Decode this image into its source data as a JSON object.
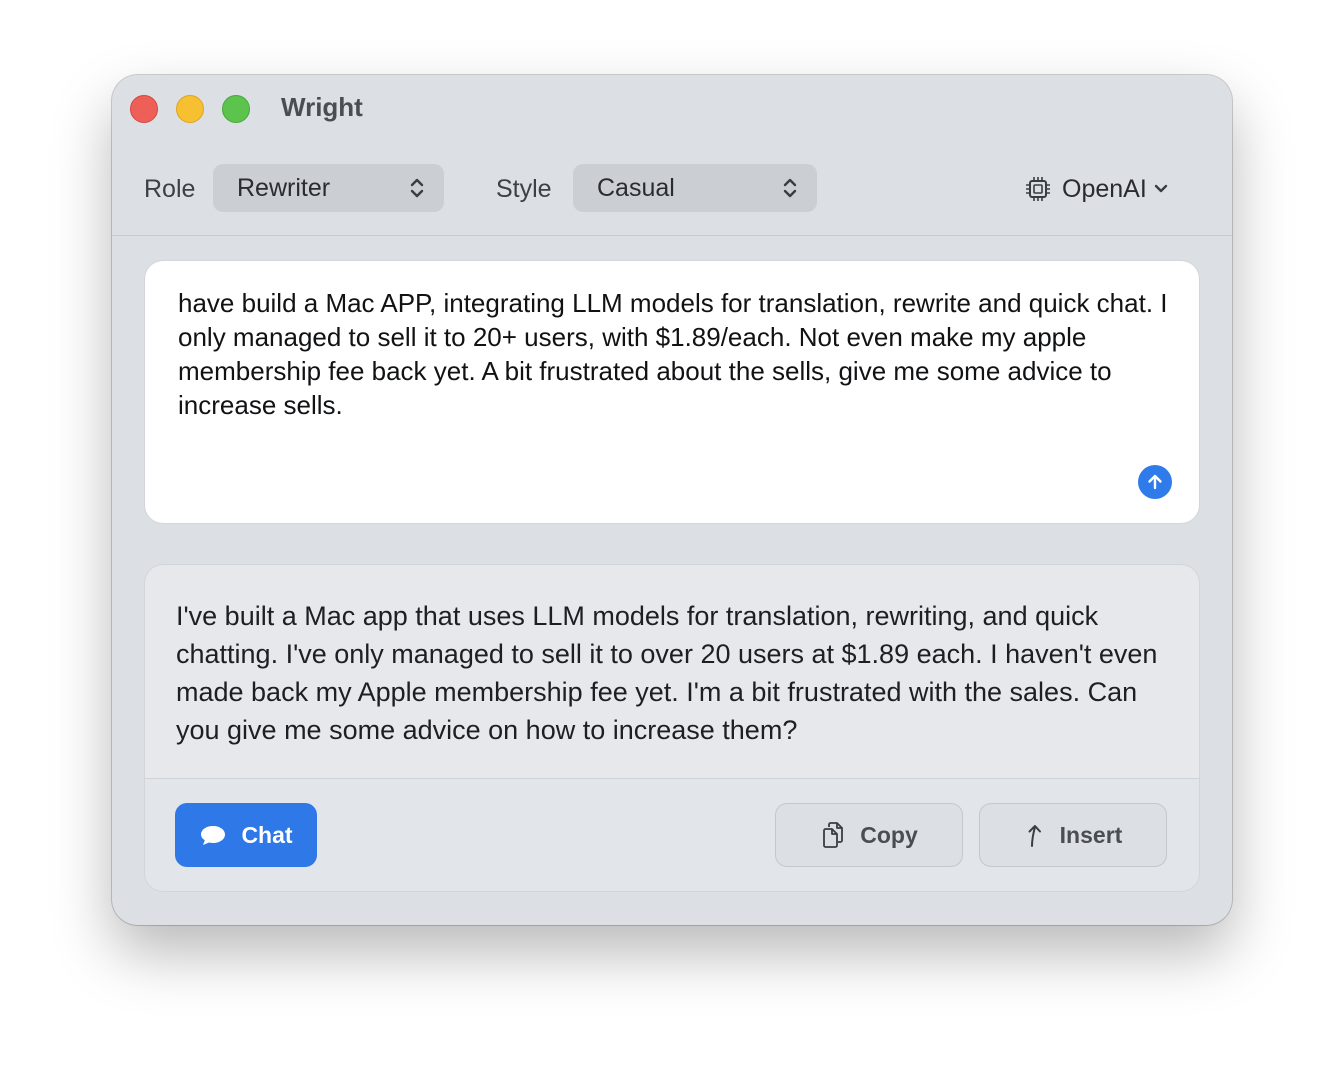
{
  "window": {
    "title": "Wright"
  },
  "toolbar": {
    "role_label": "Role",
    "role_value": "Rewriter",
    "style_label": "Style",
    "style_value": "Casual",
    "provider": "OpenAI"
  },
  "input": {
    "text": "have build a Mac APP, integrating LLM models for translation, rewrite and quick chat. I only managed to sell it to 20+ users, with $1.89/each. Not even make my apple membership fee back yet. A bit frustrated about the sells, give me some advice to increase sells."
  },
  "output": {
    "text": "I've built a Mac app that uses LLM models for translation, rewriting, and quick chatting. I've only managed to sell it to over 20 users at $1.89 each. I haven't even made back my Apple membership fee yet. I'm a bit frustrated with the sales. Can you give me some advice on how to increase them?"
  },
  "actions": {
    "chat_label": "Chat",
    "copy_label": "Copy",
    "insert_label": "Insert"
  },
  "colors": {
    "accent": "#2e78e8",
    "close": "#ee5f58",
    "minimize": "#f6c030",
    "maximize": "#5cc34c"
  },
  "icons": {
    "provider": "cpu-chip-icon",
    "send": "arrow-up-circle-icon",
    "chat": "speech-bubble-icon",
    "copy": "copy-documents-icon",
    "insert": "insert-arrow-icon"
  }
}
